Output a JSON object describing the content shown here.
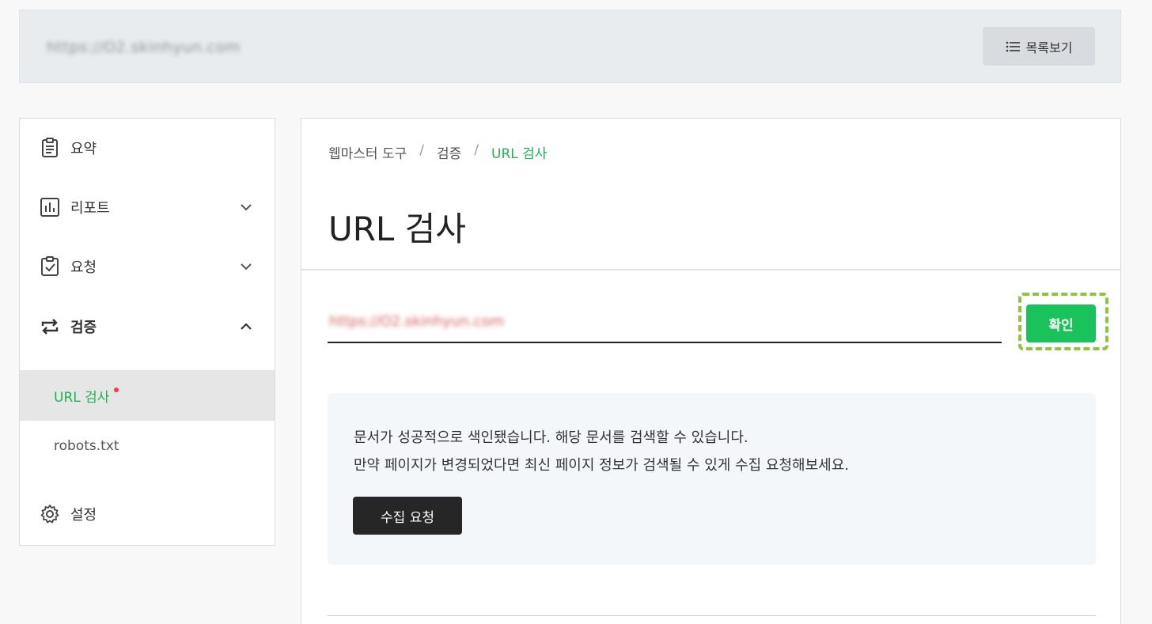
{
  "header": {
    "site_url": "https://O2.skinhyun.com",
    "list_button_label": "목록보기"
  },
  "sidebar": {
    "items": [
      {
        "label": "요약",
        "icon": "clipboard-icon"
      },
      {
        "label": "리포트",
        "icon": "bar-chart-icon",
        "expanded": false
      },
      {
        "label": "요청",
        "icon": "clipboard-check-icon",
        "expanded": false
      },
      {
        "label": "검증",
        "icon": "repeat-arrows-icon",
        "expanded": true
      },
      {
        "label": "설정",
        "icon": "gear-icon"
      }
    ],
    "sub_items": [
      {
        "label": "URL 검사",
        "active": true,
        "badge": "red-dot"
      },
      {
        "label": "robots.txt",
        "active": false
      }
    ]
  },
  "breadcrumb": {
    "items": [
      "웹마스터 도구",
      "검증",
      "URL 검사"
    ],
    "separator": "/"
  },
  "page_title": "URL 검사",
  "url_input": {
    "value": "https://O2.skinhyun.com"
  },
  "confirm_button_label": "확인",
  "info": {
    "line1": "문서가 성공적으로 색인됐습니다. 해당 문서를 검색할 수 있습니다.",
    "line2": "만약 페이지가 변경되었다면 최신 페이지 정보가 검색될 수 있게 수집 요청해보세요.",
    "collect_button_label": "수집 요청"
  },
  "colors": {
    "accent_green": "#19c25a",
    "highlight_dashed": "#8cc63f",
    "active_text": "#1db454",
    "dark_button": "#262626"
  }
}
